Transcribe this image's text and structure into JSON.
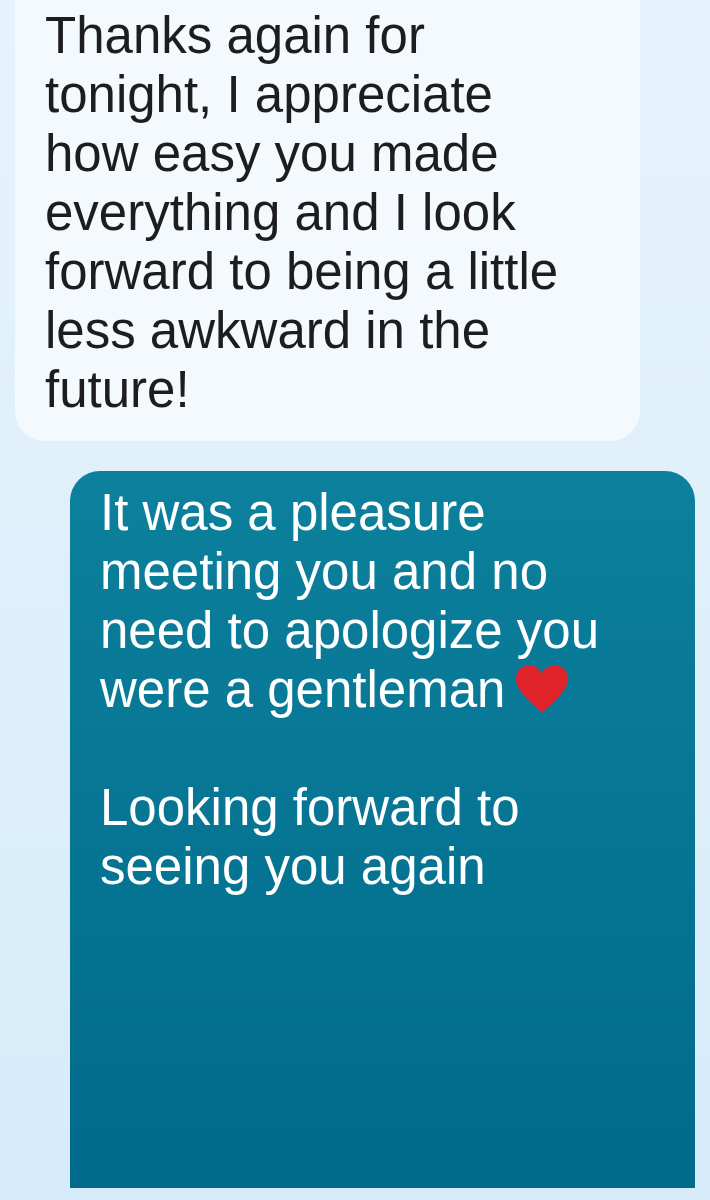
{
  "messages": [
    {
      "kind": "received",
      "paragraphs": [
        {
          "text": "Thanks again for tonight, I appreciate how easy you made everything and I look forward to being a little less awkward in the future!",
          "heart": false
        }
      ]
    },
    {
      "kind": "sent",
      "paragraphs": [
        {
          "text": "It was a pleasure meeting you and no need to apologize you were a gentleman",
          "heart": true
        },
        {
          "text": "Looking forward to seeing you again",
          "heart": false
        }
      ]
    }
  ]
}
